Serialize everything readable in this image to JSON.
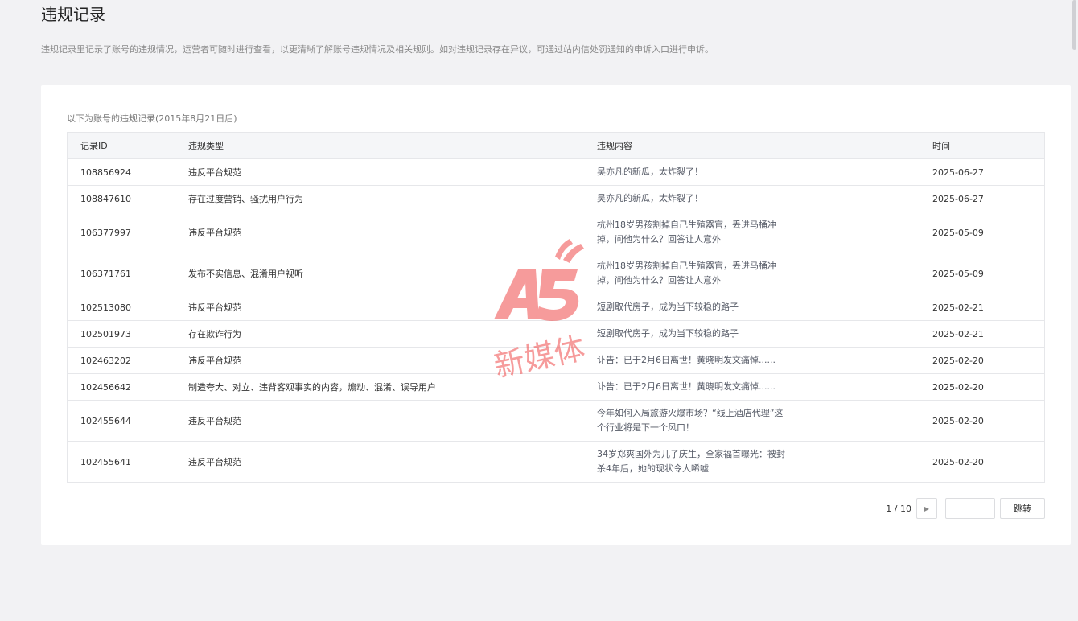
{
  "page": {
    "title": "违规记录",
    "description": "违规记录里记录了账号的违规情况，运营者可随时进行查看，以更清晰了解账号违规情况及相关规则。如对违规记录存在异议，可通过站内信处罚通知的申诉入口进行申诉。"
  },
  "table": {
    "caption": "以下为账号的违规记录(2015年8月21日后)",
    "headers": [
      "记录ID",
      "违规类型",
      "违规内容",
      "时间"
    ],
    "rows": [
      {
        "id": "108856924",
        "type": "违反平台规范",
        "content": [
          "吴亦凡的新瓜，太炸裂了！"
        ],
        "time": "2025-06-27"
      },
      {
        "id": "108847610",
        "type": "存在过度营销、骚扰用户行为",
        "content": [
          "吴亦凡的新瓜，太炸裂了！"
        ],
        "time": "2025-06-27"
      },
      {
        "id": "106377997",
        "type": "违反平台规范",
        "content": [
          "杭州18岁男孩割掉自己生殖器官，丢进马桶冲",
          "掉，问他为什么？回答让人意外"
        ],
        "time": "2025-05-09"
      },
      {
        "id": "106371761",
        "type": "发布不实信息、混淆用户视听",
        "content": [
          "杭州18岁男孩割掉自己生殖器官，丢进马桶冲",
          "掉，问他为什么？回答让人意外"
        ],
        "time": "2025-05-09"
      },
      {
        "id": "102513080",
        "type": "违反平台规范",
        "content": [
          "短剧取代房子，成为当下较稳的路子"
        ],
        "time": "2025-02-21"
      },
      {
        "id": "102501973",
        "type": "存在欺诈行为",
        "content": [
          "短剧取代房子，成为当下较稳的路子"
        ],
        "time": "2025-02-21"
      },
      {
        "id": "102463202",
        "type": "违反平台规范",
        "content": [
          "讣告：已于2月6日离世！黄晓明发文痛悼......"
        ],
        "time": "2025-02-20"
      },
      {
        "id": "102456642",
        "type": "制造夸大、对立、违背客观事实的内容，煽动、混淆、误导用户",
        "content": [
          "讣告：已于2月6日离世！黄晓明发文痛悼......"
        ],
        "time": "2025-02-20"
      },
      {
        "id": "102455644",
        "type": "违反平台规范",
        "content": [
          "今年如何入局旅游火爆市场？“线上酒店代理”这",
          "个行业将是下一个风口！"
        ],
        "time": "2025-02-20"
      },
      {
        "id": "102455641",
        "type": "违反平台规范",
        "content": [
          "34岁郑爽国外为儿子庆生，全家福首曝光：被封",
          "杀4年后，她的现状令人唏嘘"
        ],
        "time": "2025-02-20"
      }
    ]
  },
  "pager": {
    "page_info": "1 / 10",
    "next_icon": "caret-right-icon",
    "page_input_value": "",
    "jump_label": "跳转"
  },
  "watermark": {
    "logo_text": "A5",
    "brand_text": "新媒体",
    "color": "#f04a4a"
  }
}
